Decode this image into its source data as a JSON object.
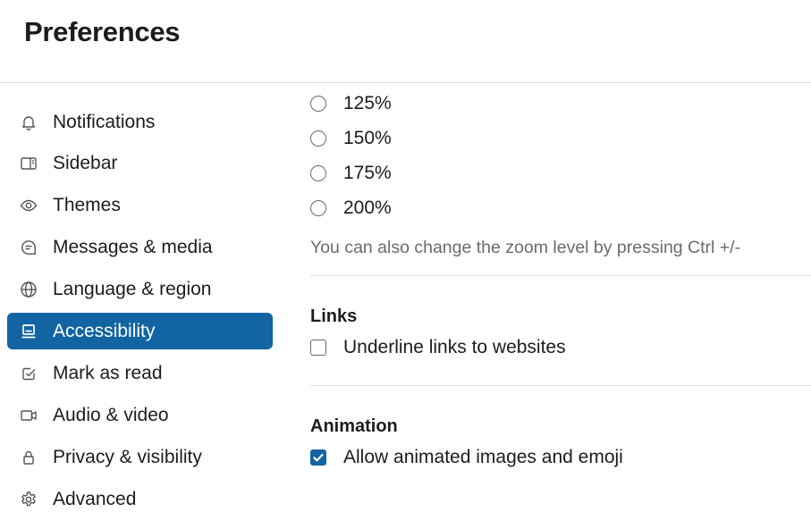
{
  "header": {
    "title": "Preferences"
  },
  "sidebar": {
    "items": [
      {
        "label": "Notifications",
        "icon": "bell-icon"
      },
      {
        "label": "Sidebar",
        "icon": "sidebar-icon"
      },
      {
        "label": "Themes",
        "icon": "eye-icon"
      },
      {
        "label": "Messages & media",
        "icon": "message-icon"
      },
      {
        "label": "Language & region",
        "icon": "globe-icon"
      },
      {
        "label": "Accessibility",
        "icon": "laptop-icon",
        "active": true
      },
      {
        "label": "Mark as read",
        "icon": "check-square-icon"
      },
      {
        "label": "Audio & video",
        "icon": "video-icon"
      },
      {
        "label": "Privacy & visibility",
        "icon": "lock-icon"
      },
      {
        "label": "Advanced",
        "icon": "gear-icon"
      }
    ]
  },
  "zoom": {
    "options": [
      "125%",
      "150%",
      "175%",
      "200%"
    ],
    "hint": "You can also change the zoom level by pressing Ctrl +/-"
  },
  "links": {
    "title": "Links",
    "underline_label": "Underline links to websites",
    "underline_checked": false
  },
  "animation": {
    "title": "Animation",
    "allow_label": "Allow animated images and emoji",
    "allow_checked": true
  },
  "colors": {
    "accent": "#1264a3",
    "divider": "#dddddd",
    "hint_text": "#6b6b6b"
  }
}
